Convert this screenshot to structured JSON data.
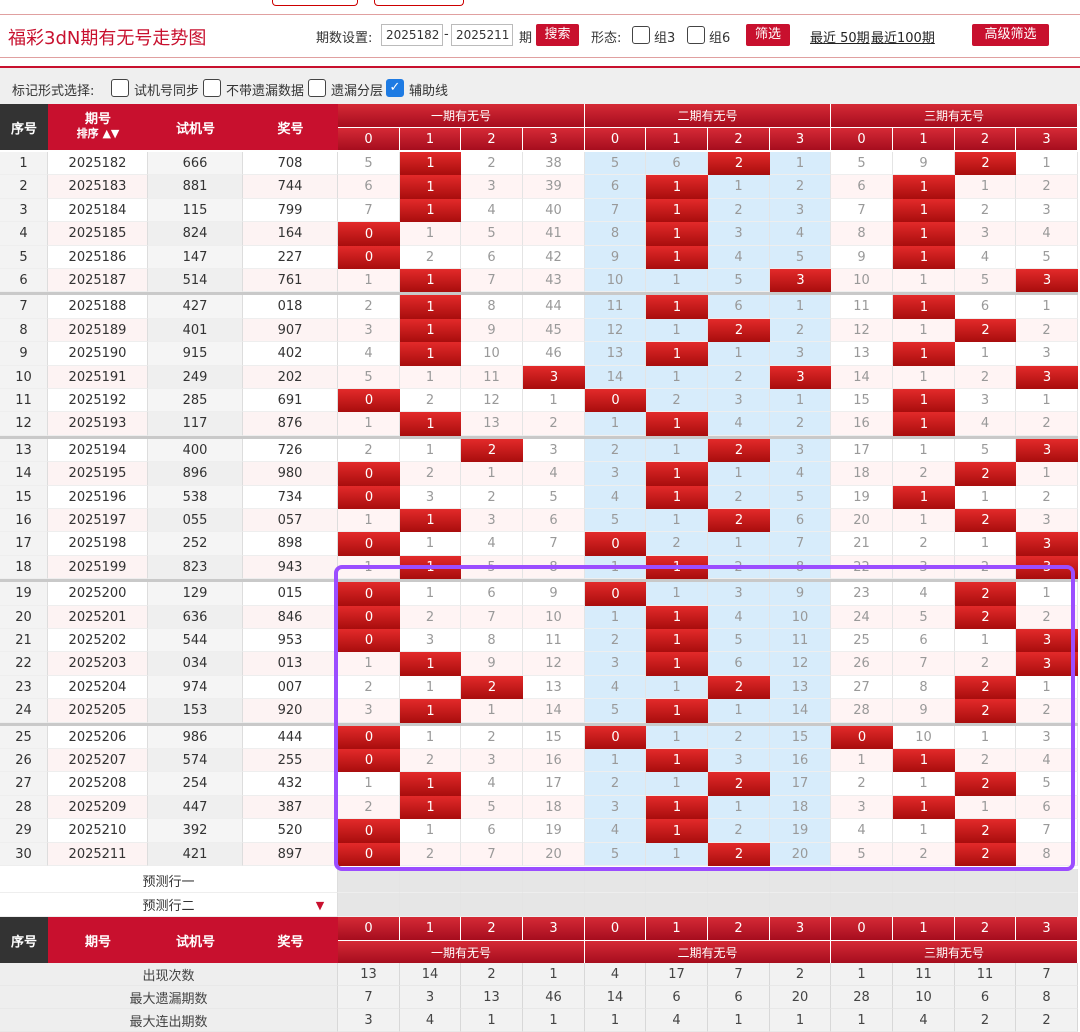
{
  "header": {
    "title": "福彩3dN期有无号走势图",
    "period_label": "期数设置:",
    "period_from": "2025182",
    "period_dash": "-",
    "period_to": "2025211",
    "period_suffix": "期",
    "search_label": "搜索",
    "shape_label": "形态:",
    "group3_label": "组3",
    "group6_label": "组6",
    "filter_label": "筛选",
    "recent50_label": "最近 50期",
    "recent100_label": "最近100期",
    "advanced_label": "高级筛选"
  },
  "options": {
    "label": "标记形式选择:",
    "items": [
      {
        "label": "试机号同步",
        "checked": false
      },
      {
        "label": "不带遗漏数据",
        "checked": false
      },
      {
        "label": "遗漏分层",
        "checked": false
      },
      {
        "label": "辅助线",
        "checked": true
      }
    ]
  },
  "table": {
    "head": {
      "seq": "序号",
      "issue": "期号",
      "sort": "排序",
      "trial": "试机号",
      "prize": "奖号",
      "groups": [
        "一期有无号",
        "二期有无号",
        "三期有无号"
      ],
      "cols": [
        "0",
        "1",
        "2",
        "3"
      ]
    },
    "rows": [
      {
        "seq": "1",
        "issue": "2025182",
        "trial": "666",
        "prize": "708",
        "v": [
          "5",
          "1",
          "2",
          "38",
          "5",
          "6",
          "2",
          "1",
          "5",
          "9",
          "2",
          "1"
        ],
        "hit": [
          false,
          true,
          false,
          false,
          false,
          false,
          true,
          false,
          false,
          false,
          true,
          false
        ]
      },
      {
        "seq": "2",
        "issue": "2025183",
        "trial": "881",
        "prize": "744",
        "v": [
          "6",
          "1",
          "3",
          "39",
          "6",
          "1",
          "1",
          "2",
          "6",
          "1",
          "1",
          "2"
        ],
        "hit": [
          false,
          true,
          false,
          false,
          false,
          true,
          false,
          false,
          false,
          true,
          false,
          false
        ]
      },
      {
        "seq": "3",
        "issue": "2025184",
        "trial": "115",
        "prize": "799",
        "v": [
          "7",
          "1",
          "4",
          "40",
          "7",
          "1",
          "2",
          "3",
          "7",
          "1",
          "2",
          "3"
        ],
        "hit": [
          false,
          true,
          false,
          false,
          false,
          true,
          false,
          false,
          false,
          true,
          false,
          false
        ]
      },
      {
        "seq": "4",
        "issue": "2025185",
        "trial": "824",
        "prize": "164",
        "v": [
          "0",
          "1",
          "5",
          "41",
          "8",
          "1",
          "3",
          "4",
          "8",
          "1",
          "3",
          "4"
        ],
        "hit": [
          true,
          false,
          false,
          false,
          false,
          true,
          false,
          false,
          false,
          true,
          false,
          false
        ]
      },
      {
        "seq": "5",
        "issue": "2025186",
        "trial": "147",
        "prize": "227",
        "v": [
          "0",
          "2",
          "6",
          "42",
          "9",
          "1",
          "4",
          "5",
          "9",
          "1",
          "4",
          "5"
        ],
        "hit": [
          true,
          false,
          false,
          false,
          false,
          true,
          false,
          false,
          false,
          true,
          false,
          false
        ]
      },
      {
        "seq": "6",
        "issue": "2025187",
        "trial": "514",
        "prize": "761",
        "v": [
          "1",
          "1",
          "7",
          "43",
          "10",
          "1",
          "5",
          "3",
          "10",
          "1",
          "5",
          "3"
        ],
        "hit": [
          false,
          true,
          false,
          false,
          false,
          false,
          false,
          true,
          false,
          false,
          false,
          true
        ]
      },
      {
        "seq": "7",
        "issue": "2025188",
        "trial": "427",
        "prize": "018",
        "v": [
          "2",
          "1",
          "8",
          "44",
          "11",
          "1",
          "6",
          "1",
          "11",
          "1",
          "6",
          "1"
        ],
        "hit": [
          false,
          true,
          false,
          false,
          false,
          true,
          false,
          false,
          false,
          true,
          false,
          false
        ]
      },
      {
        "seq": "8",
        "issue": "2025189",
        "trial": "401",
        "prize": "907",
        "v": [
          "3",
          "1",
          "9",
          "45",
          "12",
          "1",
          "2",
          "2",
          "12",
          "1",
          "2",
          "2"
        ],
        "hit": [
          false,
          true,
          false,
          false,
          false,
          false,
          true,
          false,
          false,
          false,
          true,
          false
        ]
      },
      {
        "seq": "9",
        "issue": "2025190",
        "trial": "915",
        "prize": "402",
        "v": [
          "4",
          "1",
          "10",
          "46",
          "13",
          "1",
          "1",
          "3",
          "13",
          "1",
          "1",
          "3"
        ],
        "hit": [
          false,
          true,
          false,
          false,
          false,
          true,
          false,
          false,
          false,
          true,
          false,
          false
        ]
      },
      {
        "seq": "10",
        "issue": "2025191",
        "trial": "249",
        "prize": "202",
        "v": [
          "5",
          "1",
          "11",
          "3",
          "14",
          "1",
          "2",
          "3",
          "14",
          "1",
          "2",
          "3"
        ],
        "hit": [
          false,
          false,
          false,
          true,
          false,
          false,
          false,
          true,
          false,
          false,
          false,
          true
        ]
      },
      {
        "seq": "11",
        "issue": "2025192",
        "trial": "285",
        "prize": "691",
        "v": [
          "0",
          "2",
          "12",
          "1",
          "0",
          "2",
          "3",
          "1",
          "15",
          "1",
          "3",
          "1"
        ],
        "hit": [
          true,
          false,
          false,
          false,
          true,
          false,
          false,
          false,
          false,
          true,
          false,
          false
        ]
      },
      {
        "seq": "12",
        "issue": "2025193",
        "trial": "117",
        "prize": "876",
        "v": [
          "1",
          "1",
          "13",
          "2",
          "1",
          "1",
          "4",
          "2",
          "16",
          "1",
          "4",
          "2"
        ],
        "hit": [
          false,
          true,
          false,
          false,
          false,
          true,
          false,
          false,
          false,
          true,
          false,
          false
        ]
      },
      {
        "seq": "13",
        "issue": "2025194",
        "trial": "400",
        "prize": "726",
        "v": [
          "2",
          "1",
          "2",
          "3",
          "2",
          "1",
          "2",
          "3",
          "17",
          "1",
          "5",
          "3"
        ],
        "hit": [
          false,
          false,
          true,
          false,
          false,
          false,
          true,
          false,
          false,
          false,
          false,
          true
        ]
      },
      {
        "seq": "14",
        "issue": "2025195",
        "trial": "896",
        "prize": "980",
        "v": [
          "0",
          "2",
          "1",
          "4",
          "3",
          "1",
          "1",
          "4",
          "18",
          "2",
          "2",
          "1"
        ],
        "hit": [
          true,
          false,
          false,
          false,
          false,
          true,
          false,
          false,
          false,
          false,
          true,
          false
        ]
      },
      {
        "seq": "15",
        "issue": "2025196",
        "trial": "538",
        "prize": "734",
        "v": [
          "0",
          "3",
          "2",
          "5",
          "4",
          "1",
          "2",
          "5",
          "19",
          "1",
          "1",
          "2"
        ],
        "hit": [
          true,
          false,
          false,
          false,
          false,
          true,
          false,
          false,
          false,
          true,
          false,
          false
        ]
      },
      {
        "seq": "16",
        "issue": "2025197",
        "trial": "055",
        "prize": "057",
        "v": [
          "1",
          "1",
          "3",
          "6",
          "5",
          "1",
          "2",
          "6",
          "20",
          "1",
          "2",
          "3"
        ],
        "hit": [
          false,
          true,
          false,
          false,
          false,
          false,
          true,
          false,
          false,
          false,
          true,
          false
        ]
      },
      {
        "seq": "17",
        "issue": "2025198",
        "trial": "252",
        "prize": "898",
        "v": [
          "0",
          "1",
          "4",
          "7",
          "0",
          "2",
          "1",
          "7",
          "21",
          "2",
          "1",
          "3"
        ],
        "hit": [
          true,
          false,
          false,
          false,
          true,
          false,
          false,
          false,
          false,
          false,
          false,
          true
        ]
      },
      {
        "seq": "18",
        "issue": "2025199",
        "trial": "823",
        "prize": "943",
        "v": [
          "1",
          "1",
          "5",
          "8",
          "1",
          "1",
          "2",
          "8",
          "22",
          "3",
          "2",
          "3"
        ],
        "hit": [
          false,
          true,
          false,
          false,
          false,
          true,
          false,
          false,
          false,
          false,
          false,
          true
        ]
      },
      {
        "seq": "19",
        "issue": "2025200",
        "trial": "129",
        "prize": "015",
        "v": [
          "0",
          "1",
          "6",
          "9",
          "0",
          "1",
          "3",
          "9",
          "23",
          "4",
          "2",
          "1"
        ],
        "hit": [
          true,
          false,
          false,
          false,
          true,
          false,
          false,
          false,
          false,
          false,
          true,
          false
        ]
      },
      {
        "seq": "20",
        "issue": "2025201",
        "trial": "636",
        "prize": "846",
        "v": [
          "0",
          "2",
          "7",
          "10",
          "1",
          "1",
          "4",
          "10",
          "24",
          "5",
          "2",
          "2"
        ],
        "hit": [
          true,
          false,
          false,
          false,
          false,
          true,
          false,
          false,
          false,
          false,
          true,
          false
        ]
      },
      {
        "seq": "21",
        "issue": "2025202",
        "trial": "544",
        "prize": "953",
        "v": [
          "0",
          "3",
          "8",
          "11",
          "2",
          "1",
          "5",
          "11",
          "25",
          "6",
          "1",
          "3"
        ],
        "hit": [
          true,
          false,
          false,
          false,
          false,
          true,
          false,
          false,
          false,
          false,
          false,
          true
        ]
      },
      {
        "seq": "22",
        "issue": "2025203",
        "trial": "034",
        "prize": "013",
        "v": [
          "1",
          "1",
          "9",
          "12",
          "3",
          "1",
          "6",
          "12",
          "26",
          "7",
          "2",
          "3"
        ],
        "hit": [
          false,
          true,
          false,
          false,
          false,
          true,
          false,
          false,
          false,
          false,
          false,
          true
        ]
      },
      {
        "seq": "23",
        "issue": "2025204",
        "trial": "974",
        "prize": "007",
        "v": [
          "2",
          "1",
          "2",
          "13",
          "4",
          "1",
          "2",
          "13",
          "27",
          "8",
          "2",
          "1"
        ],
        "hit": [
          false,
          false,
          true,
          false,
          false,
          false,
          true,
          false,
          false,
          false,
          true,
          false
        ]
      },
      {
        "seq": "24",
        "issue": "2025205",
        "trial": "153",
        "prize": "920",
        "v": [
          "3",
          "1",
          "1",
          "14",
          "5",
          "1",
          "1",
          "14",
          "28",
          "9",
          "2",
          "2"
        ],
        "hit": [
          false,
          true,
          false,
          false,
          false,
          true,
          false,
          false,
          false,
          false,
          true,
          false
        ]
      },
      {
        "seq": "25",
        "issue": "2025206",
        "trial": "986",
        "prize": "444",
        "v": [
          "0",
          "1",
          "2",
          "15",
          "0",
          "1",
          "2",
          "15",
          "0",
          "10",
          "1",
          "3"
        ],
        "hit": [
          true,
          false,
          false,
          false,
          true,
          false,
          false,
          false,
          true,
          false,
          false,
          false
        ]
      },
      {
        "seq": "26",
        "issue": "2025207",
        "trial": "574",
        "prize": "255",
        "v": [
          "0",
          "2",
          "3",
          "16",
          "1",
          "1",
          "3",
          "16",
          "1",
          "1",
          "2",
          "4"
        ],
        "hit": [
          true,
          false,
          false,
          false,
          false,
          true,
          false,
          false,
          false,
          true,
          false,
          false
        ]
      },
      {
        "seq": "27",
        "issue": "2025208",
        "trial": "254",
        "prize": "432",
        "v": [
          "1",
          "1",
          "4",
          "17",
          "2",
          "1",
          "2",
          "17",
          "2",
          "1",
          "2",
          "5"
        ],
        "hit": [
          false,
          true,
          false,
          false,
          false,
          false,
          true,
          false,
          false,
          false,
          true,
          false
        ]
      },
      {
        "seq": "28",
        "issue": "2025209",
        "trial": "447",
        "prize": "387",
        "v": [
          "2",
          "1",
          "5",
          "18",
          "3",
          "1",
          "1",
          "18",
          "3",
          "1",
          "1",
          "6"
        ],
        "hit": [
          false,
          true,
          false,
          false,
          false,
          true,
          false,
          false,
          false,
          true,
          false,
          false
        ]
      },
      {
        "seq": "29",
        "issue": "2025210",
        "trial": "392",
        "prize": "520",
        "v": [
          "0",
          "1",
          "6",
          "19",
          "4",
          "1",
          "2",
          "19",
          "4",
          "1",
          "2",
          "7"
        ],
        "hit": [
          true,
          false,
          false,
          false,
          false,
          true,
          false,
          false,
          false,
          false,
          true,
          false
        ]
      },
      {
        "seq": "30",
        "issue": "2025211",
        "trial": "421",
        "prize": "897",
        "v": [
          "0",
          "2",
          "7",
          "20",
          "5",
          "1",
          "2",
          "20",
          "5",
          "2",
          "2",
          "8"
        ],
        "hit": [
          true,
          false,
          false,
          false,
          false,
          false,
          true,
          false,
          false,
          false,
          true,
          false
        ]
      }
    ],
    "predict_rows": [
      "预测行一",
      "预测行二"
    ],
    "stats": [
      {
        "label": "出现次数",
        "v": [
          "13",
          "14",
          "2",
          "1",
          "4",
          "17",
          "7",
          "2",
          "1",
          "11",
          "11",
          "7"
        ]
      },
      {
        "label": "最大遗漏期数",
        "v": [
          "7",
          "3",
          "13",
          "46",
          "14",
          "6",
          "6",
          "20",
          "28",
          "10",
          "6",
          "8"
        ]
      },
      {
        "label": "最大连出期数",
        "v": [
          "3",
          "4",
          "1",
          "1",
          "1",
          "4",
          "1",
          "1",
          "1",
          "4",
          "2",
          "2"
        ]
      }
    ]
  }
}
